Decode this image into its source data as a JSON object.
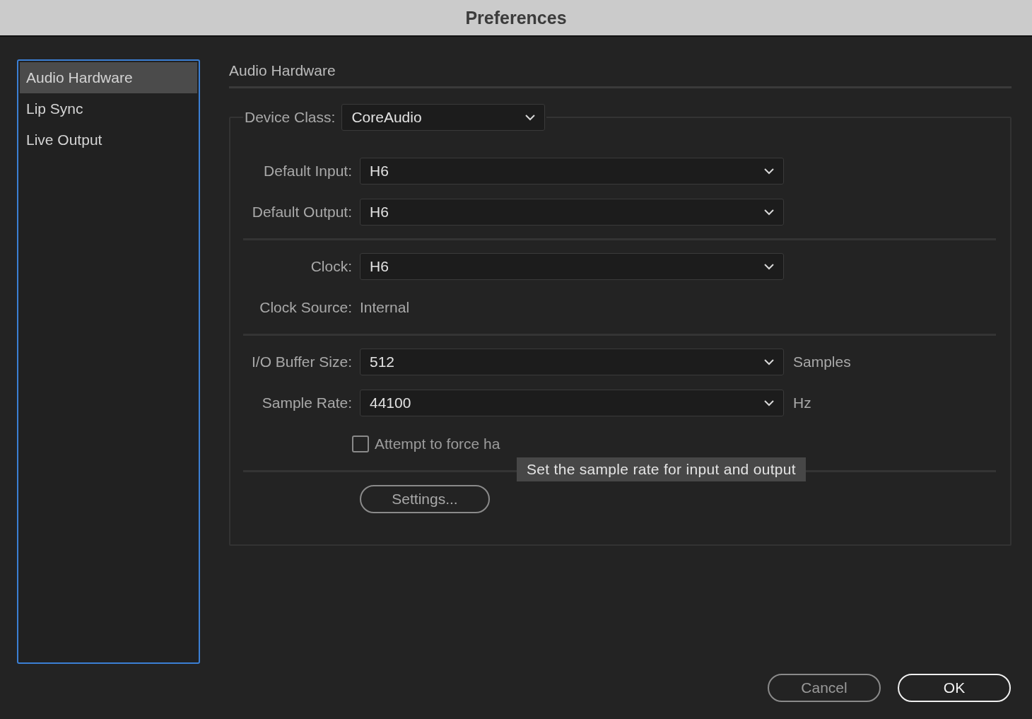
{
  "window": {
    "title": "Preferences"
  },
  "sidebar": {
    "items": [
      {
        "label": "Audio Hardware",
        "selected": true
      },
      {
        "label": "Lip Sync",
        "selected": false
      },
      {
        "label": "Live Output",
        "selected": false
      }
    ]
  },
  "section_title": "Audio Hardware",
  "device_class": {
    "label": "Device Class:",
    "value": "CoreAudio"
  },
  "sections": [
    {
      "rows": [
        {
          "kind": "dropdown",
          "label": "Default Input:",
          "value": "H6"
        },
        {
          "kind": "dropdown",
          "label": "Default Output:",
          "value": "H6"
        }
      ]
    },
    {
      "rows": [
        {
          "kind": "dropdown",
          "label": "Clock:",
          "value": "H6"
        },
        {
          "kind": "text",
          "label": "Clock Source:",
          "value": "Internal"
        }
      ]
    },
    {
      "rows": [
        {
          "kind": "dropdown",
          "label": "I/O Buffer Size:",
          "value": "512",
          "unit": "Samples"
        },
        {
          "kind": "dropdown",
          "label": "Sample Rate:",
          "value": "44100",
          "unit": "Hz"
        },
        {
          "kind": "checkbox",
          "label": "Attempt to force ha",
          "checked": false
        }
      ]
    },
    {
      "rows": [
        {
          "kind": "button",
          "label": "Settings..."
        }
      ]
    }
  ],
  "tooltip": {
    "text": "Set the sample rate for input and output"
  },
  "buttons": [
    {
      "label": "Cancel",
      "default": false
    },
    {
      "label": "OK",
      "default": true
    }
  ]
}
